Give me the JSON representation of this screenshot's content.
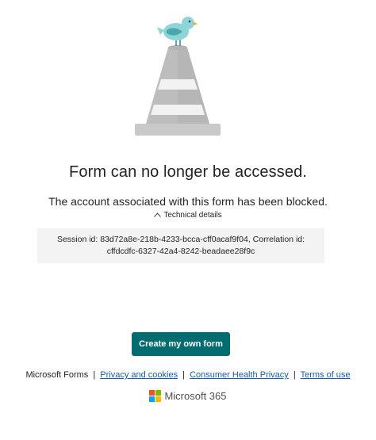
{
  "page": {
    "title": "Form can no longer be accessed.",
    "subtitle": "The account associated with this form has been blocked.",
    "details_toggle_label": "Technical details",
    "details_text": "Session id: 83d72a8e-218b-4233-bcca-cff0acaf9f04, Correlation id: cffdcdfc-6327-42a4-8242-beadaee28f9c"
  },
  "actions": {
    "create_label": "Create my own form"
  },
  "footer": {
    "brand": "Microsoft Forms",
    "separator": "|",
    "links": [
      "Privacy and cookies",
      "Consumer Health Privacy",
      "Terms of use"
    ]
  },
  "logo": {
    "label": "Microsoft 365",
    "colors": [
      "#f25022",
      "#7fba00",
      "#00a4ef",
      "#ffb900"
    ]
  },
  "colors": {
    "accent": "#036c70",
    "link": "#1a5ba6",
    "details_background": "#f3f3f3",
    "bird": "#8fd4d9",
    "cone": "#c8c8c8"
  },
  "icons": {
    "illustration": "traffic-cone-with-bird",
    "toggle": "chevron-up-icon",
    "logo": "microsoft-logo-icon"
  }
}
